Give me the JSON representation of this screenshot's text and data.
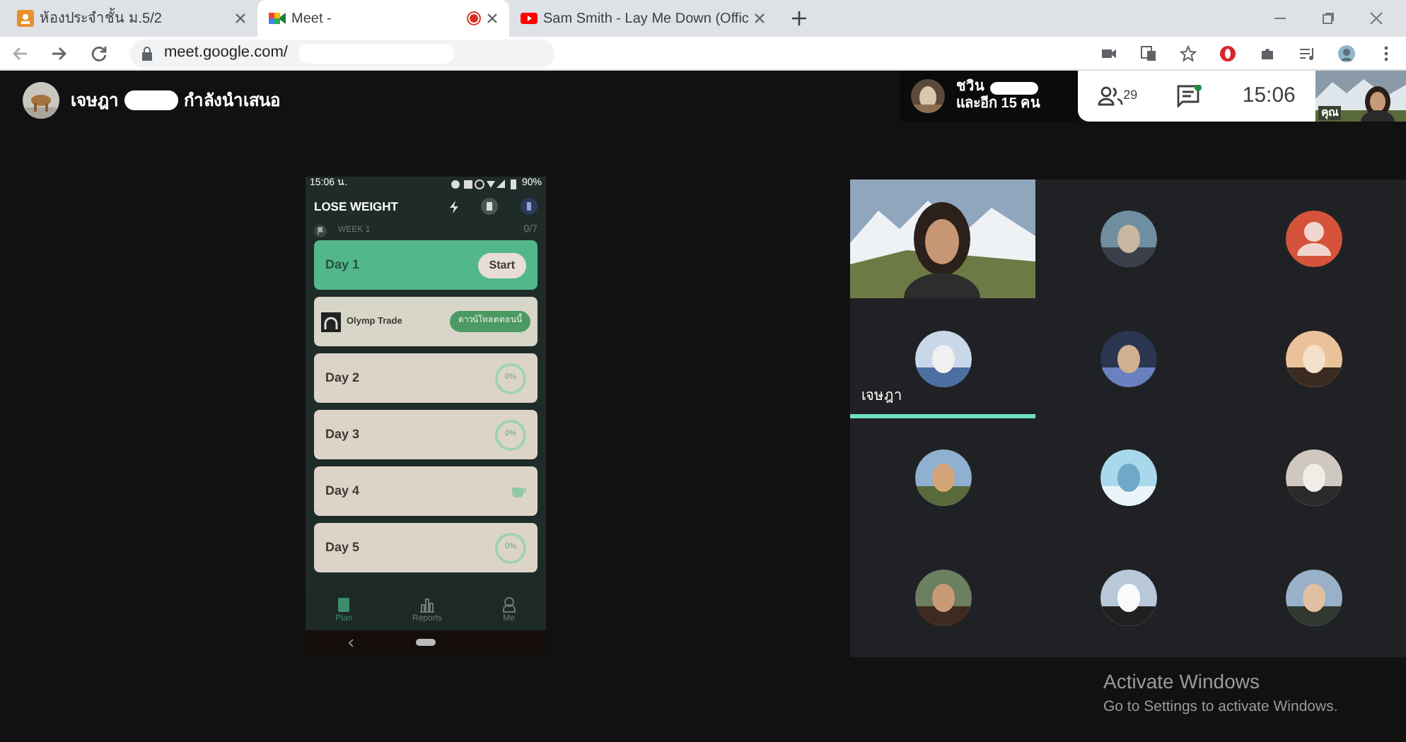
{
  "browser": {
    "tabs": [
      {
        "title": "ห้องประจำชั้น ม.5/2",
        "selected": false,
        "recording": false
      },
      {
        "title": "Meet -",
        "selected": true,
        "recording": true
      },
      {
        "title": "Sam Smith - Lay Me Down (Offic",
        "selected": false,
        "recording": false
      }
    ],
    "address": "meet.google.com/"
  },
  "meet": {
    "presenter": {
      "name": "เจษฎา",
      "status": "กำลังนำเสนอ"
    },
    "speaker_chip": {
      "name": "ชวิน",
      "others": "และอีก 15 คน"
    },
    "participant_count": "29",
    "chat_unread": true,
    "clock": "15:06",
    "self_label": "คุณ"
  },
  "phone": {
    "status_time": "15:06 น.",
    "battery": "90%",
    "title": "LOSE WEIGHT",
    "week": "WEEK 1",
    "week_progress": "0/7",
    "cards": [
      {
        "kind": "start",
        "label": "Day 1",
        "action": "Start"
      },
      {
        "kind": "ad",
        "label": "Olymp Trade",
        "action": "ดาวน์โหลดตอนนี้"
      },
      {
        "kind": "day",
        "label": "Day 2",
        "progress": "0%"
      },
      {
        "kind": "day",
        "label": "Day 3",
        "progress": "0%"
      },
      {
        "kind": "rest",
        "label": "Day 4"
      },
      {
        "kind": "day",
        "label": "Day 5",
        "progress": "0%"
      }
    ],
    "nav": [
      {
        "label": "Plan",
        "selected": true
      },
      {
        "label": "Reports",
        "selected": false
      },
      {
        "label": "Me",
        "selected": false
      }
    ]
  },
  "tiles": [
    {
      "kind": "video"
    },
    {
      "kind": "avatar"
    },
    {
      "kind": "generic"
    },
    {
      "kind": "avatar",
      "name": "เจษฎา",
      "speaking": true
    },
    {
      "kind": "avatar"
    },
    {
      "kind": "avatar"
    },
    {
      "kind": "avatar"
    },
    {
      "kind": "avatar"
    },
    {
      "kind": "avatar"
    },
    {
      "kind": "avatar"
    },
    {
      "kind": "avatar"
    },
    {
      "kind": "avatar"
    }
  ],
  "activation": {
    "title": "Activate Windows",
    "hint": "Go to Settings to activate Windows."
  }
}
